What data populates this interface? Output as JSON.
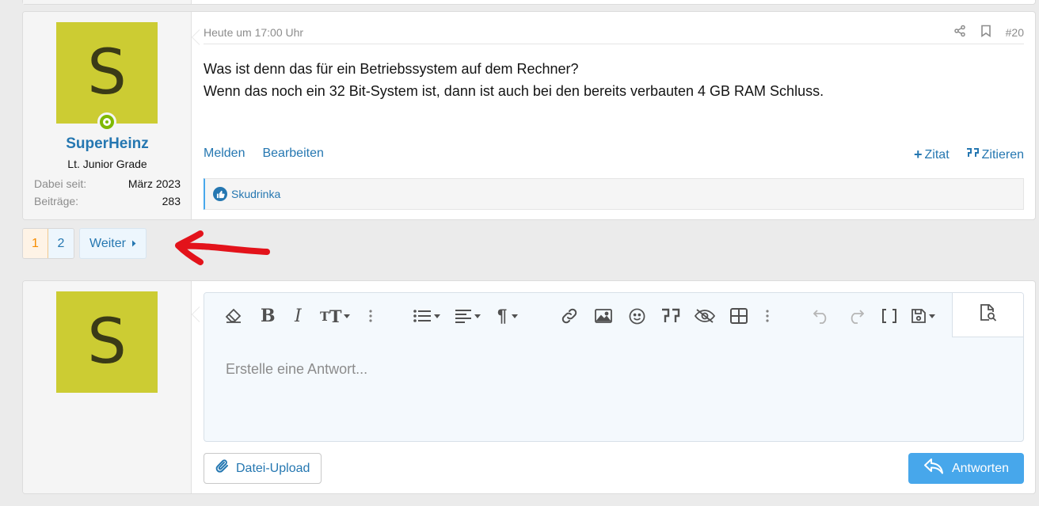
{
  "post": {
    "date": "Heute um 17:00 Uhr",
    "number": "#20",
    "avatar_letter": "S",
    "username": "SuperHeinz",
    "user_title": "Lt. Junior Grade",
    "stats": [
      {
        "label": "Dabei seit:",
        "value": "März 2023"
      },
      {
        "label": "Beiträge:",
        "value": "283"
      }
    ],
    "body_lines": [
      "Was ist denn das für ein Betriebssystem auf dem Rechner?",
      "Wenn das noch ein 32 Bit-System ist, dann ist auch bei den bereits verbauten 4 GB RAM Schluss."
    ],
    "actions_left": [
      "Melden",
      "Bearbeiten"
    ],
    "actions_right": [
      "Zitat",
      "Zitieren"
    ],
    "reaction_user": "Skudrinka"
  },
  "pagination": {
    "pages": [
      "1",
      "2"
    ],
    "current": "1",
    "next_label": "Weiter"
  },
  "reply": {
    "avatar_letter": "S",
    "placeholder": "Erstelle eine Antwort...",
    "upload_label": "Datei-Upload",
    "submit_label": "Antworten"
  },
  "colors": {
    "avatar_bg": "#cccc33",
    "link": "#2577b1",
    "accent": "#47a7eb",
    "annotation_arrow": "#e3131b"
  }
}
